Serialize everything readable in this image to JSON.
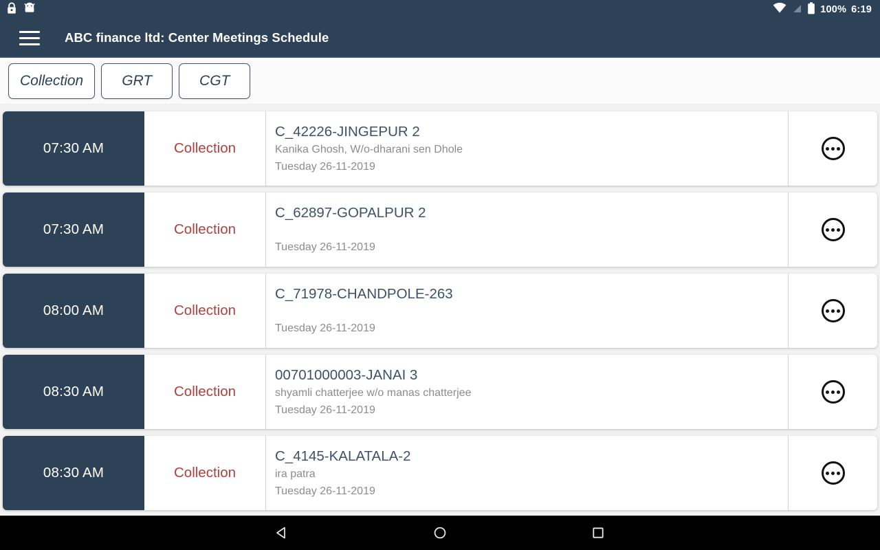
{
  "status_bar": {
    "left_icons": [
      "lock-icon",
      "android-robot-icon"
    ],
    "right_icons": [
      "wifi-icon",
      "signal-off-icon",
      "battery-icon"
    ],
    "battery_percent": "100%",
    "clock": "6:19"
  },
  "app_bar": {
    "menu_icon": "hamburger-menu-icon",
    "title": "ABC finance ltd: Center Meetings Schedule"
  },
  "tabs": [
    {
      "label": "Collection"
    },
    {
      "label": "GRT"
    },
    {
      "label": "CGT"
    }
  ],
  "meetings": [
    {
      "time": "07:30 AM",
      "type": "Collection",
      "center": "C_42226-JINGEPUR 2",
      "contact": "Kanika Ghosh, W/o-dharani  sen Dhole",
      "date": "Tuesday 26-11-2019",
      "action_icon": "more-options-icon"
    },
    {
      "time": "07:30 AM",
      "type": "Collection",
      "center": "C_62897-GOPALPUR 2",
      "contact": "",
      "date": "Tuesday 26-11-2019",
      "action_icon": "more-options-icon"
    },
    {
      "time": "08:00 AM",
      "type": "Collection",
      "center": "C_71978-CHANDPOLE-263",
      "contact": "",
      "date": "Tuesday 26-11-2019",
      "action_icon": "more-options-icon"
    },
    {
      "time": "08:30 AM",
      "type": "Collection",
      "center": "00701000003-JANAI 3",
      "contact": "shyamli chatterjee w/o manas chatterjee",
      "date": "Tuesday 26-11-2019",
      "action_icon": "more-options-icon"
    },
    {
      "time": "08:30 AM",
      "type": "Collection",
      "center": "C_4145-KALATALA-2",
      "contact": "ira patra",
      "date": "Tuesday 26-11-2019",
      "action_icon": "more-options-icon"
    }
  ],
  "nav_bar": {
    "back": "back-triangle-icon",
    "home": "home-circle-icon",
    "recents": "recents-square-icon"
  },
  "colors": {
    "primary": "#2d4157",
    "accent_red": "#b0413e",
    "title_text": "#3d5268",
    "muted_text": "#8c8c8c",
    "page_bg": "#f2f2f2"
  }
}
